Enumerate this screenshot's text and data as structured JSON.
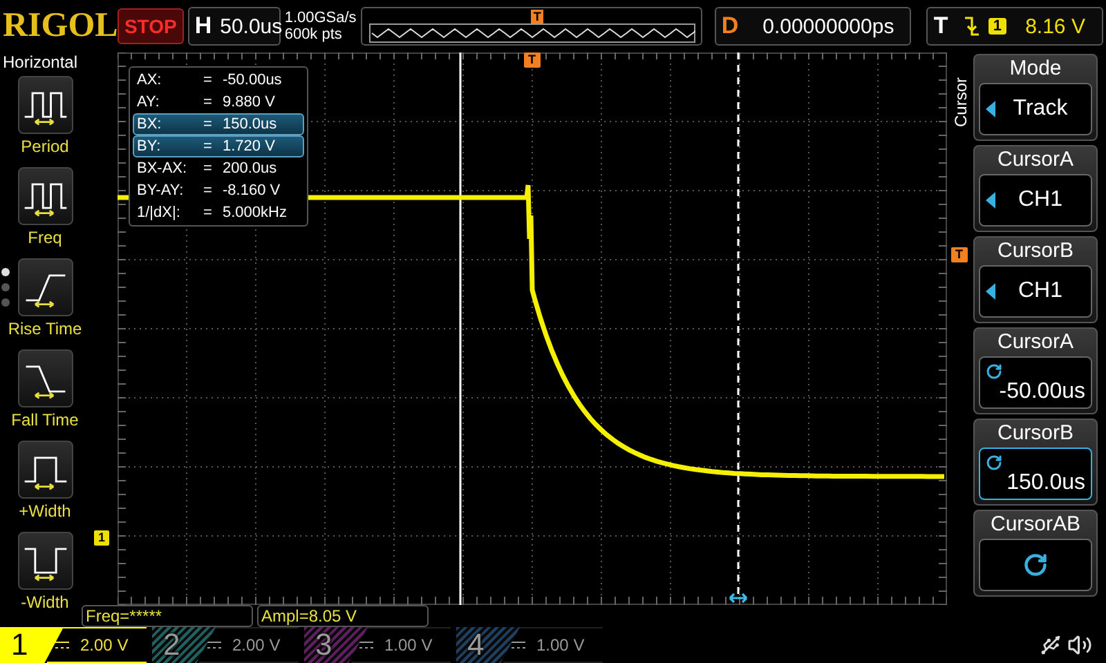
{
  "header": {
    "logo": "RIGOL",
    "run_state": "STOP",
    "timebase": {
      "label": "H",
      "value": "50.0us"
    },
    "sample_rate": "1.00GSa/s",
    "memory_depth": "600k pts",
    "memory_marker": "T",
    "delay": {
      "label": "D",
      "value": "0.00000000ps"
    },
    "trigger": {
      "label": "T",
      "source": "1",
      "level": "8.16 V"
    }
  },
  "left_menu": {
    "title": "Horizontal",
    "page_dots": [
      {
        "selected": true
      },
      {
        "selected": false
      },
      {
        "selected": false
      }
    ],
    "items": [
      {
        "kind": "period",
        "label": "Period"
      },
      {
        "kind": "freq",
        "label": "Freq"
      },
      {
        "kind": "rise",
        "label": "Rise Time"
      },
      {
        "kind": "fall",
        "label": "Fall Time"
      },
      {
        "kind": "pwidth",
        "label": "+Width"
      },
      {
        "kind": "nwidth",
        "label": "-Width"
      }
    ]
  },
  "screen": {
    "trigger_position_marker": "T",
    "trigger_level_marker": "T",
    "channel_marker": "1",
    "cursor_readout": [
      {
        "label": "AX:",
        "equals": "=",
        "value": "-50.00us",
        "selected": false
      },
      {
        "label": "AY:",
        "equals": "=",
        "value": "9.880 V",
        "selected": false
      },
      {
        "label": "BX:",
        "equals": "=",
        "value": "150.0us",
        "selected": true
      },
      {
        "label": "BY:",
        "equals": "=",
        "value": "1.720 V",
        "selected": true
      },
      {
        "label": "BX-AX:",
        "equals": "=",
        "value": "200.0us",
        "selected": false
      },
      {
        "label": "BY-AY:",
        "equals": "=",
        "value": "-8.160 V",
        "selected": false
      },
      {
        "label": "1/|dX|:",
        "equals": "=",
        "value": "5.000kHz",
        "selected": false
      }
    ]
  },
  "measurements": [
    "Freq=*****",
    "Ampl=8.05 V"
  ],
  "right_menu": {
    "title": "Cursor",
    "items": [
      {
        "kind": "select",
        "title": "Mode",
        "value": "Track",
        "selected": false
      },
      {
        "kind": "select",
        "title": "CursorA",
        "value": "CH1",
        "selected": false
      },
      {
        "kind": "select",
        "title": "CursorB",
        "value": "CH1",
        "selected": false
      },
      {
        "kind": "knob",
        "title": "CursorA",
        "value": "-50.00us",
        "selected": false
      },
      {
        "kind": "knob",
        "title": "CursorB",
        "value": "150.0us",
        "selected": true
      },
      {
        "kind": "knob",
        "title": "CursorAB",
        "selected": false
      }
    ]
  },
  "channels": [
    {
      "number": "1",
      "scale": "2.00 V",
      "color": "#ffff00",
      "active": true
    },
    {
      "number": "2",
      "scale": "2.00 V",
      "color": "#1e5f5f",
      "active": false
    },
    {
      "number": "3",
      "scale": "1.00 V",
      "color": "#5f1e5f",
      "active": false
    },
    {
      "number": "4",
      "scale": "1.00 V",
      "color": "#1e3f5f",
      "active": false
    }
  ]
}
